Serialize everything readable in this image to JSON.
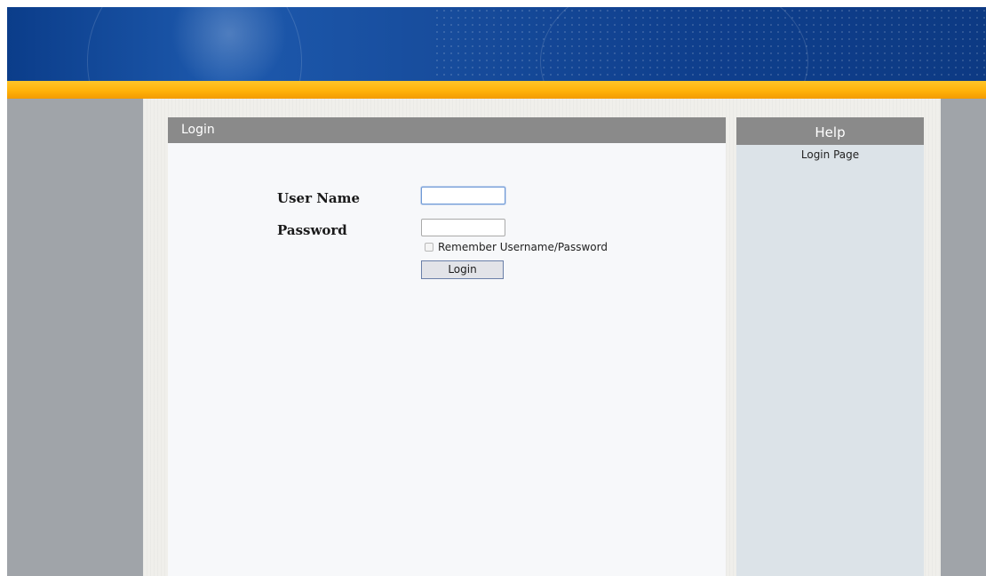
{
  "login": {
    "title": "Login",
    "username_label": "User Name",
    "password_label": "Password",
    "username_value": "",
    "password_value": "",
    "remember_label": "Remember Username/Password",
    "remember_checked": false,
    "button_label": "Login"
  },
  "help": {
    "title": "Help",
    "text": "Login Page"
  },
  "colors": {
    "banner_blue": "#1d59ad",
    "stripe_orange": "#ffb20a",
    "panel_header_gray": "#8a8a8a",
    "help_background": "#dce3e8"
  }
}
